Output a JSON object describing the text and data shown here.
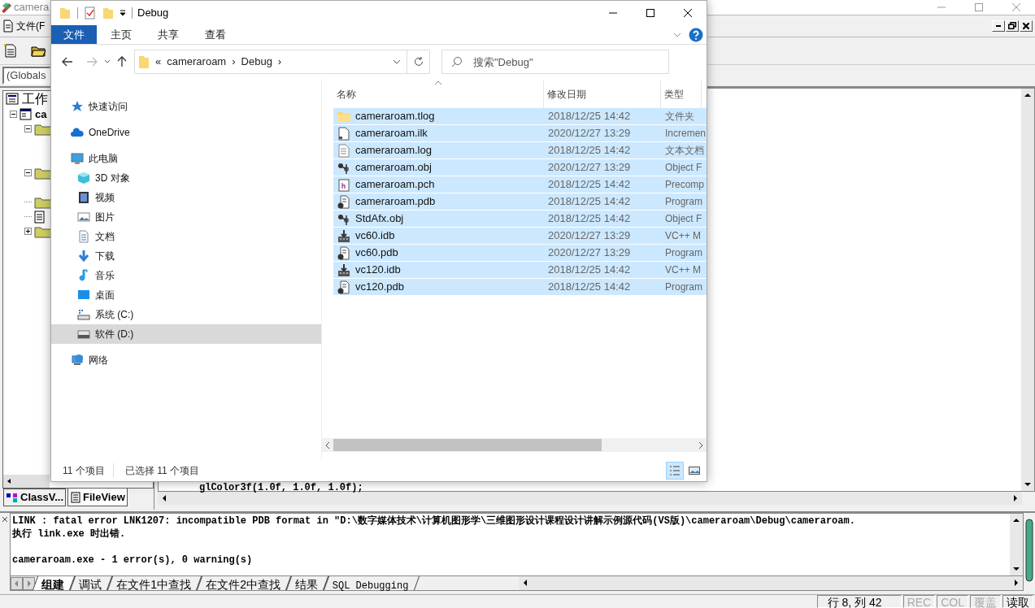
{
  "ide": {
    "title": "camera",
    "menu": [
      "文件(F"
    ],
    "combo": "(Globals",
    "workspace_title": "工作",
    "tree": [
      {
        "label": "ca",
        "kind": "project",
        "expanded": true,
        "children": [
          {
            "kind": "folder",
            "expanded": true,
            "children": [
              {
                "kind": "leaf"
              },
              {
                "kind": "leaf"
              }
            ]
          },
          {
            "kind": "folder",
            "expanded": true,
            "children": [
              {
                "kind": "leaf"
              }
            ]
          },
          {
            "kind": "folder"
          },
          {
            "kind": "file"
          },
          {
            "kind": "folder",
            "expanded": false
          }
        ]
      }
    ],
    "panel_tabs": [
      {
        "label": "ClassV...",
        "selected": false
      },
      {
        "label": "FileView",
        "selected": true
      }
    ],
    "code_line": "glColor3f(1.0f, 1.0f, 1.0f);",
    "output_lines": [
      "LINK : fatal error LNK1207: incompatible PDB format in \"D:\\数字媒体技术\\计算机图形学\\三维图形设计课程设计讲解示例源代码(VS版)\\cameraroam\\Debug\\cameraroam.",
      "执行 link.exe 时出错.",
      "cameraroam.exe - 1 error(s), 0 warning(s)"
    ],
    "output_tabs": [
      {
        "label": "组建",
        "selected": true
      },
      {
        "label": "调试",
        "selected": false
      },
      {
        "label": "在文件1中查找",
        "selected": false
      },
      {
        "label": "在文件2中查找",
        "selected": false
      },
      {
        "label": "结果",
        "selected": false
      },
      {
        "label": "SQL Debugging",
        "selected": false
      }
    ],
    "status_bar": [
      {
        "text": "行 8, 列 42",
        "disabled": false
      },
      {
        "text": "REC",
        "disabled": true
      },
      {
        "text": "COL",
        "disabled": true
      },
      {
        "text": "覆盖",
        "disabled": true
      },
      {
        "text": "读取",
        "disabled": false
      }
    ]
  },
  "explorer": {
    "title": "Debug",
    "ribbon_tabs": [
      {
        "label": "文件",
        "selected": true
      },
      {
        "label": "主页",
        "selected": false
      },
      {
        "label": "共享",
        "selected": false
      },
      {
        "label": "查看",
        "selected": false
      }
    ],
    "address": [
      "«",
      "cameraroam",
      "›",
      "Debug",
      "›"
    ],
    "search": {
      "placeholder": "搜索\"Debug\""
    },
    "nav": [
      {
        "label": "快速访问",
        "selected": false
      },
      {
        "label": "OneDrive",
        "selected": false
      },
      {
        "label": "此电脑",
        "selected": false,
        "children": [
          {
            "label": "3D 对象",
            "selected": false
          },
          {
            "label": "视频",
            "selected": false
          },
          {
            "label": "图片",
            "selected": false
          },
          {
            "label": "文档",
            "selected": false
          },
          {
            "label": "下载",
            "selected": false
          },
          {
            "label": "音乐",
            "selected": false
          },
          {
            "label": "桌面",
            "selected": false
          },
          {
            "label": "系统 (C:)",
            "selected": false
          },
          {
            "label": "软件 (D:)",
            "selected": true
          }
        ]
      },
      {
        "label": "网络",
        "selected": false
      }
    ],
    "columns": [
      "名称",
      "修改日期",
      "类型"
    ],
    "files": [
      {
        "name": "cameraroam.tlog",
        "date": "2018/12/25 14:42",
        "type": "文件夹",
        "kind": "folder",
        "selected": true
      },
      {
        "name": "cameraroam.ilk",
        "date": "2020/12/27 13:29",
        "type": "Incremen",
        "kind": "ilk",
        "selected": true
      },
      {
        "name": "cameraroam.log",
        "date": "2018/12/25 14:42",
        "type": "文本文档",
        "kind": "text",
        "selected": true
      },
      {
        "name": "cameraroam.obj",
        "date": "2020/12/27 13:29",
        "type": "Object F",
        "kind": "obj",
        "selected": true
      },
      {
        "name": "cameraroam.pch",
        "date": "2018/12/25 14:42",
        "type": "Precomp",
        "kind": "pch",
        "selected": true
      },
      {
        "name": "cameraroam.pdb",
        "date": "2018/12/25 14:42",
        "type": "Program",
        "kind": "pdb",
        "selected": true
      },
      {
        "name": "StdAfx.obj",
        "date": "2018/12/25 14:42",
        "type": "Object F",
        "kind": "obj",
        "selected": true
      },
      {
        "name": "vc60.idb",
        "date": "2020/12/27 13:29",
        "type": "VC++ M",
        "kind": "idb",
        "selected": true
      },
      {
        "name": "vc60.pdb",
        "date": "2020/12/27 13:29",
        "type": "Program",
        "kind": "pdb",
        "selected": true
      },
      {
        "name": "vc120.idb",
        "date": "2018/12/25 14:42",
        "type": "VC++ M",
        "kind": "idb",
        "selected": true
      },
      {
        "name": "vc120.pdb",
        "date": "2018/12/25 14:42",
        "type": "Program",
        "kind": "pdb",
        "selected": true
      }
    ],
    "status": [
      "11 个项目",
      "已选择 11 个项目"
    ]
  }
}
